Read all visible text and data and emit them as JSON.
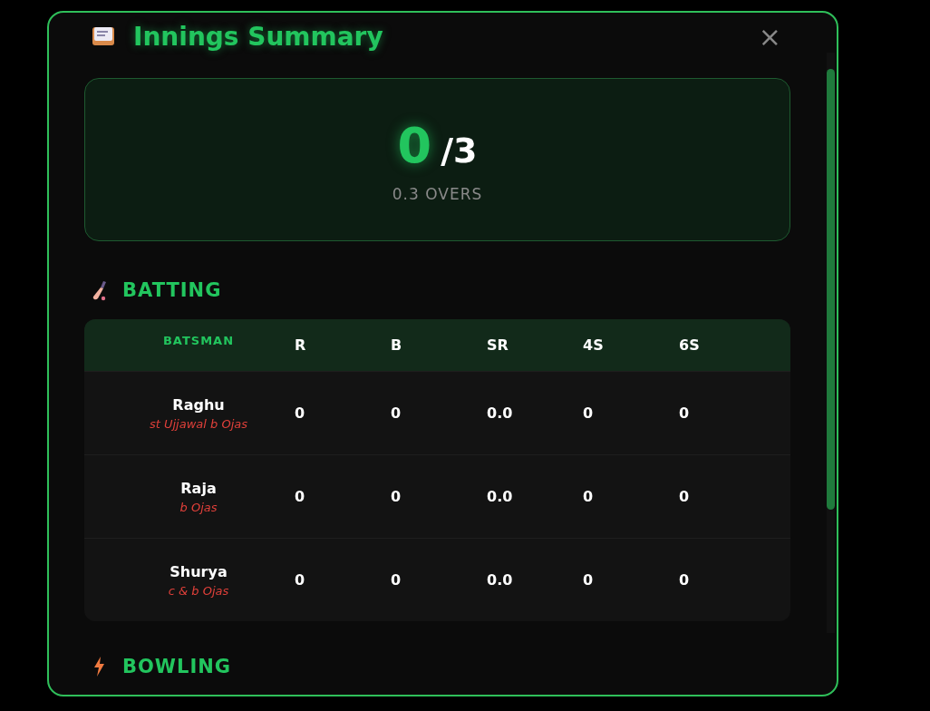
{
  "modal": {
    "title": "Innings Summary",
    "close": "×"
  },
  "score": {
    "runs": "0",
    "wickets": "/3",
    "overs": "0.3 OVERS"
  },
  "batting": {
    "heading": "BATTING",
    "name_column": "BATSMAN",
    "columns": [
      "R",
      "B",
      "SR",
      "4S",
      "6S"
    ],
    "rows": [
      {
        "name": "Raghu",
        "dismissal": "st Ujjawal b Ojas",
        "cells": [
          "0",
          "0",
          "0.0",
          "0",
          "0"
        ]
      },
      {
        "name": "Raja",
        "dismissal": "b Ojas",
        "cells": [
          "0",
          "0",
          "0.0",
          "0",
          "0"
        ]
      },
      {
        "name": "Shurya",
        "dismissal": "c & b Ojas",
        "cells": [
          "0",
          "0",
          "0.0",
          "0",
          "0"
        ]
      }
    ]
  },
  "bowling": {
    "heading": "BOWLING"
  }
}
